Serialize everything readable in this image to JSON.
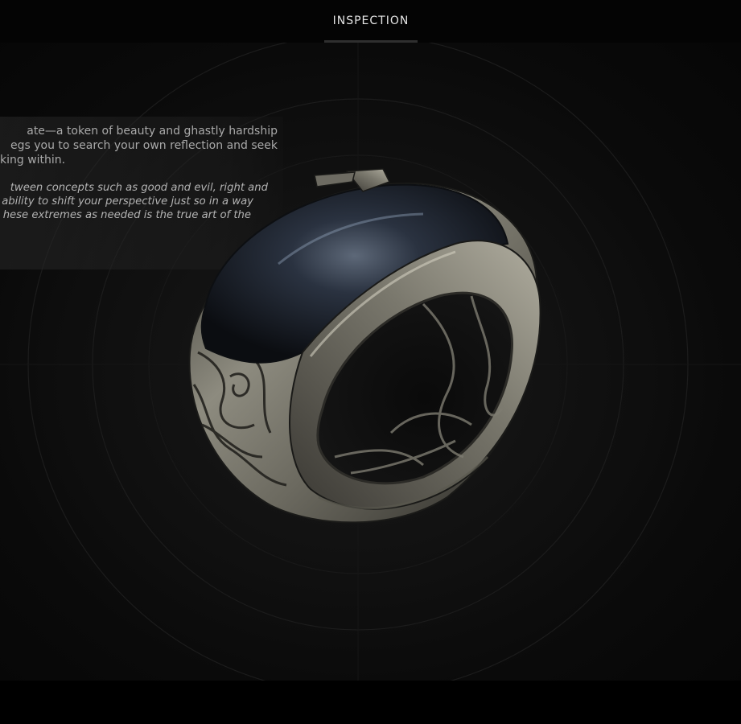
{
  "header": {
    "tabs": [
      {
        "label": "INSPECTION",
        "active": true
      }
    ]
  },
  "item": {
    "name": "",
    "icon": "ring-icon",
    "description": [
      "ate—a token of beauty and ghastly hardship",
      "egs you to search your own reflection and seek",
      "king within."
    ],
    "lore": [
      "tween concepts such as good and evil, right and",
      "ability to shift your perspective just so in a way",
      "hese extremes as needed is the true art of the"
    ]
  },
  "colors": {
    "background": "#030303",
    "text": "#a9a9a9",
    "tab_text": "#e4e4e4",
    "metal": "#8c8a80",
    "stone": "#1c2430"
  }
}
